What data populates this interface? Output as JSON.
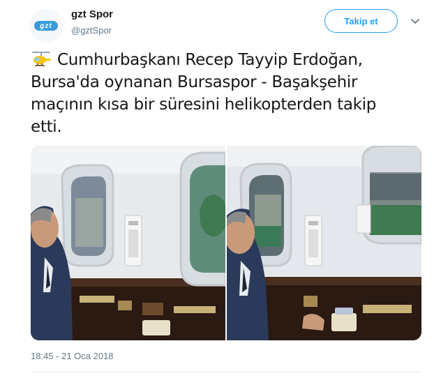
{
  "account": {
    "name": "gzt Spor",
    "handle": "@gztSpor",
    "avatar_logo": "gzt"
  },
  "follow_label": "Takip et",
  "tweet": {
    "text": "Cumhurbaşkanı Recep Tayyip Erdoğan, Bursa'da oynanan Bursaspor - Başakşehir maçının kısa bir süresini helikopterden takip etti.",
    "emoji": "helicopter-icon"
  },
  "media": {
    "photos": [
      "photo-1",
      "photo-2"
    ]
  },
  "timestamp": "18:45 - 21 Oca 2018",
  "colors": {
    "accent": "#1da1f2",
    "muted": "#657786",
    "avatar_logo": "#3a9bd9"
  }
}
